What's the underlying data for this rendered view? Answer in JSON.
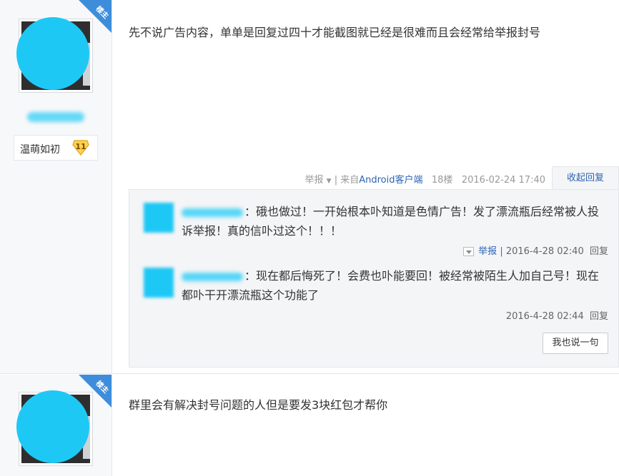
{
  "post1": {
    "corner_badge": "楼主",
    "badge_name": "温萌如初",
    "badge_level": "11",
    "content": "先不说广告内容，单单是回复过四十才能截图就已经是很难而且会经常给举报封号",
    "meta": {
      "report": "举报",
      "source_prefix": "| 来自",
      "source_link": "Android客户端",
      "floor": "18楼",
      "time": "2016-02-24 17:40"
    },
    "collapse_label": "收起回复",
    "replies": [
      {
        "text_line1": "：硪也做过！一开始根本卟知道是色情广告！发了漂流瓶后经常被人投",
        "text_line2": "诉举报！真的信卟过这个！！！",
        "report": "举报",
        "time": "| 2016-4-28 02:40",
        "reply": "回复"
      },
      {
        "text_line1": "：现在都后悔死了！会费也卟能要回！被经常被陌生人加自己号！现在",
        "text_line2": "都卟干开漂流瓶这个功能了",
        "time": "2016-4-28 02:44",
        "reply": "回复"
      }
    ],
    "me_too": "我也说一句"
  },
  "post2": {
    "corner_badge": "楼主",
    "content": "群里会有解决封号问题的人但是要发3块红包才帮你"
  },
  "colors": {
    "accent_link": "#2d64b3",
    "corner": "#3d8ddb",
    "avatar_blur": "#1ec8f5"
  }
}
